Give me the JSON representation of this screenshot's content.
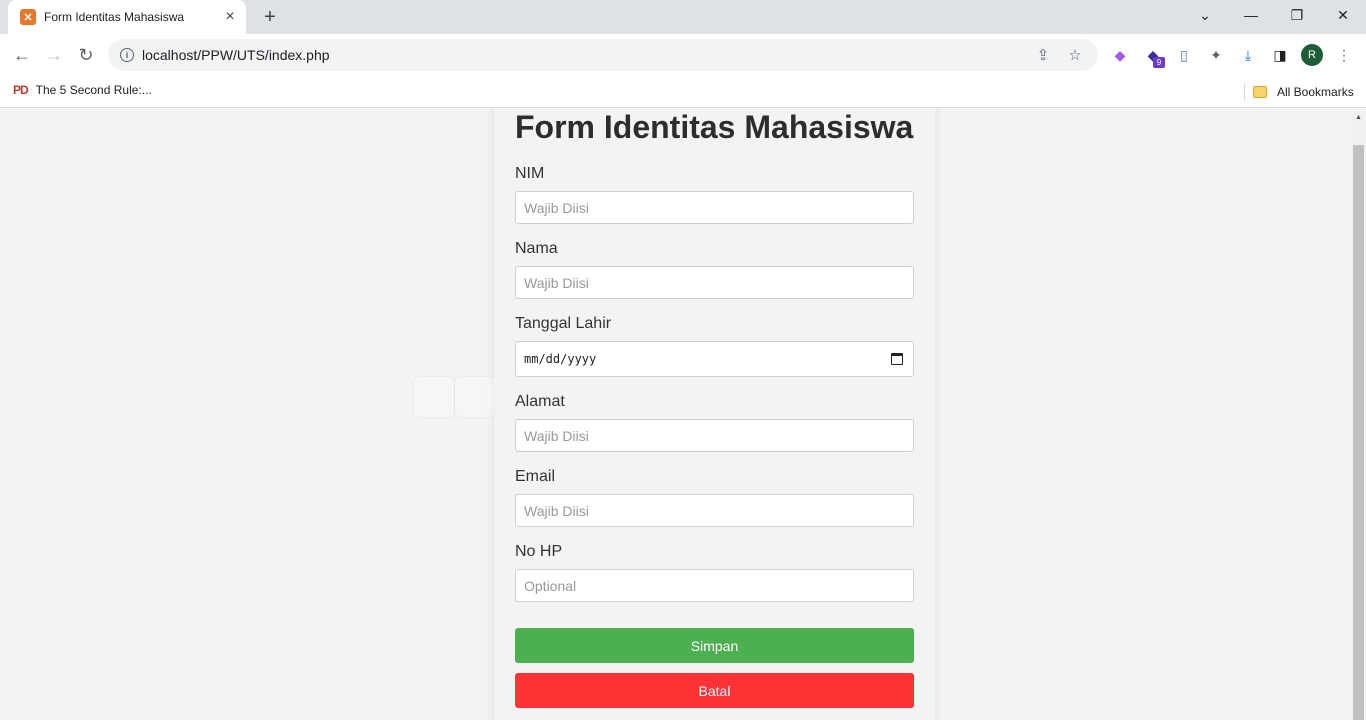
{
  "browser": {
    "tab_title": "Form Identitas Mahasiswa",
    "url": "localhost/PPW/UTS/index.php",
    "extension_badge": "9",
    "profile_initial": "R",
    "bookmarks": [
      {
        "label": "The 5 Second Rule:..."
      }
    ],
    "all_bookmarks_label": "All Bookmarks"
  },
  "form": {
    "title": "Form Identitas Mahasiswa",
    "fields": [
      {
        "label": "NIM",
        "placeholder": "Wajib Diisi"
      },
      {
        "label": "Nama",
        "placeholder": "Wajib Diisi"
      },
      {
        "label": "Tanggal Lahir",
        "placeholder": "mm/dd/yyyy"
      },
      {
        "label": "Alamat",
        "placeholder": "Wajib Diisi"
      },
      {
        "label": "Email",
        "placeholder": "Wajib Diisi"
      },
      {
        "label": "No HP",
        "placeholder": "Optional"
      }
    ],
    "save_label": "Simpan",
    "cancel_label": "Batal"
  },
  "colors": {
    "save_button": "#4caf50",
    "cancel_button": "#ff3236",
    "page_background": "#f3f3f3"
  }
}
